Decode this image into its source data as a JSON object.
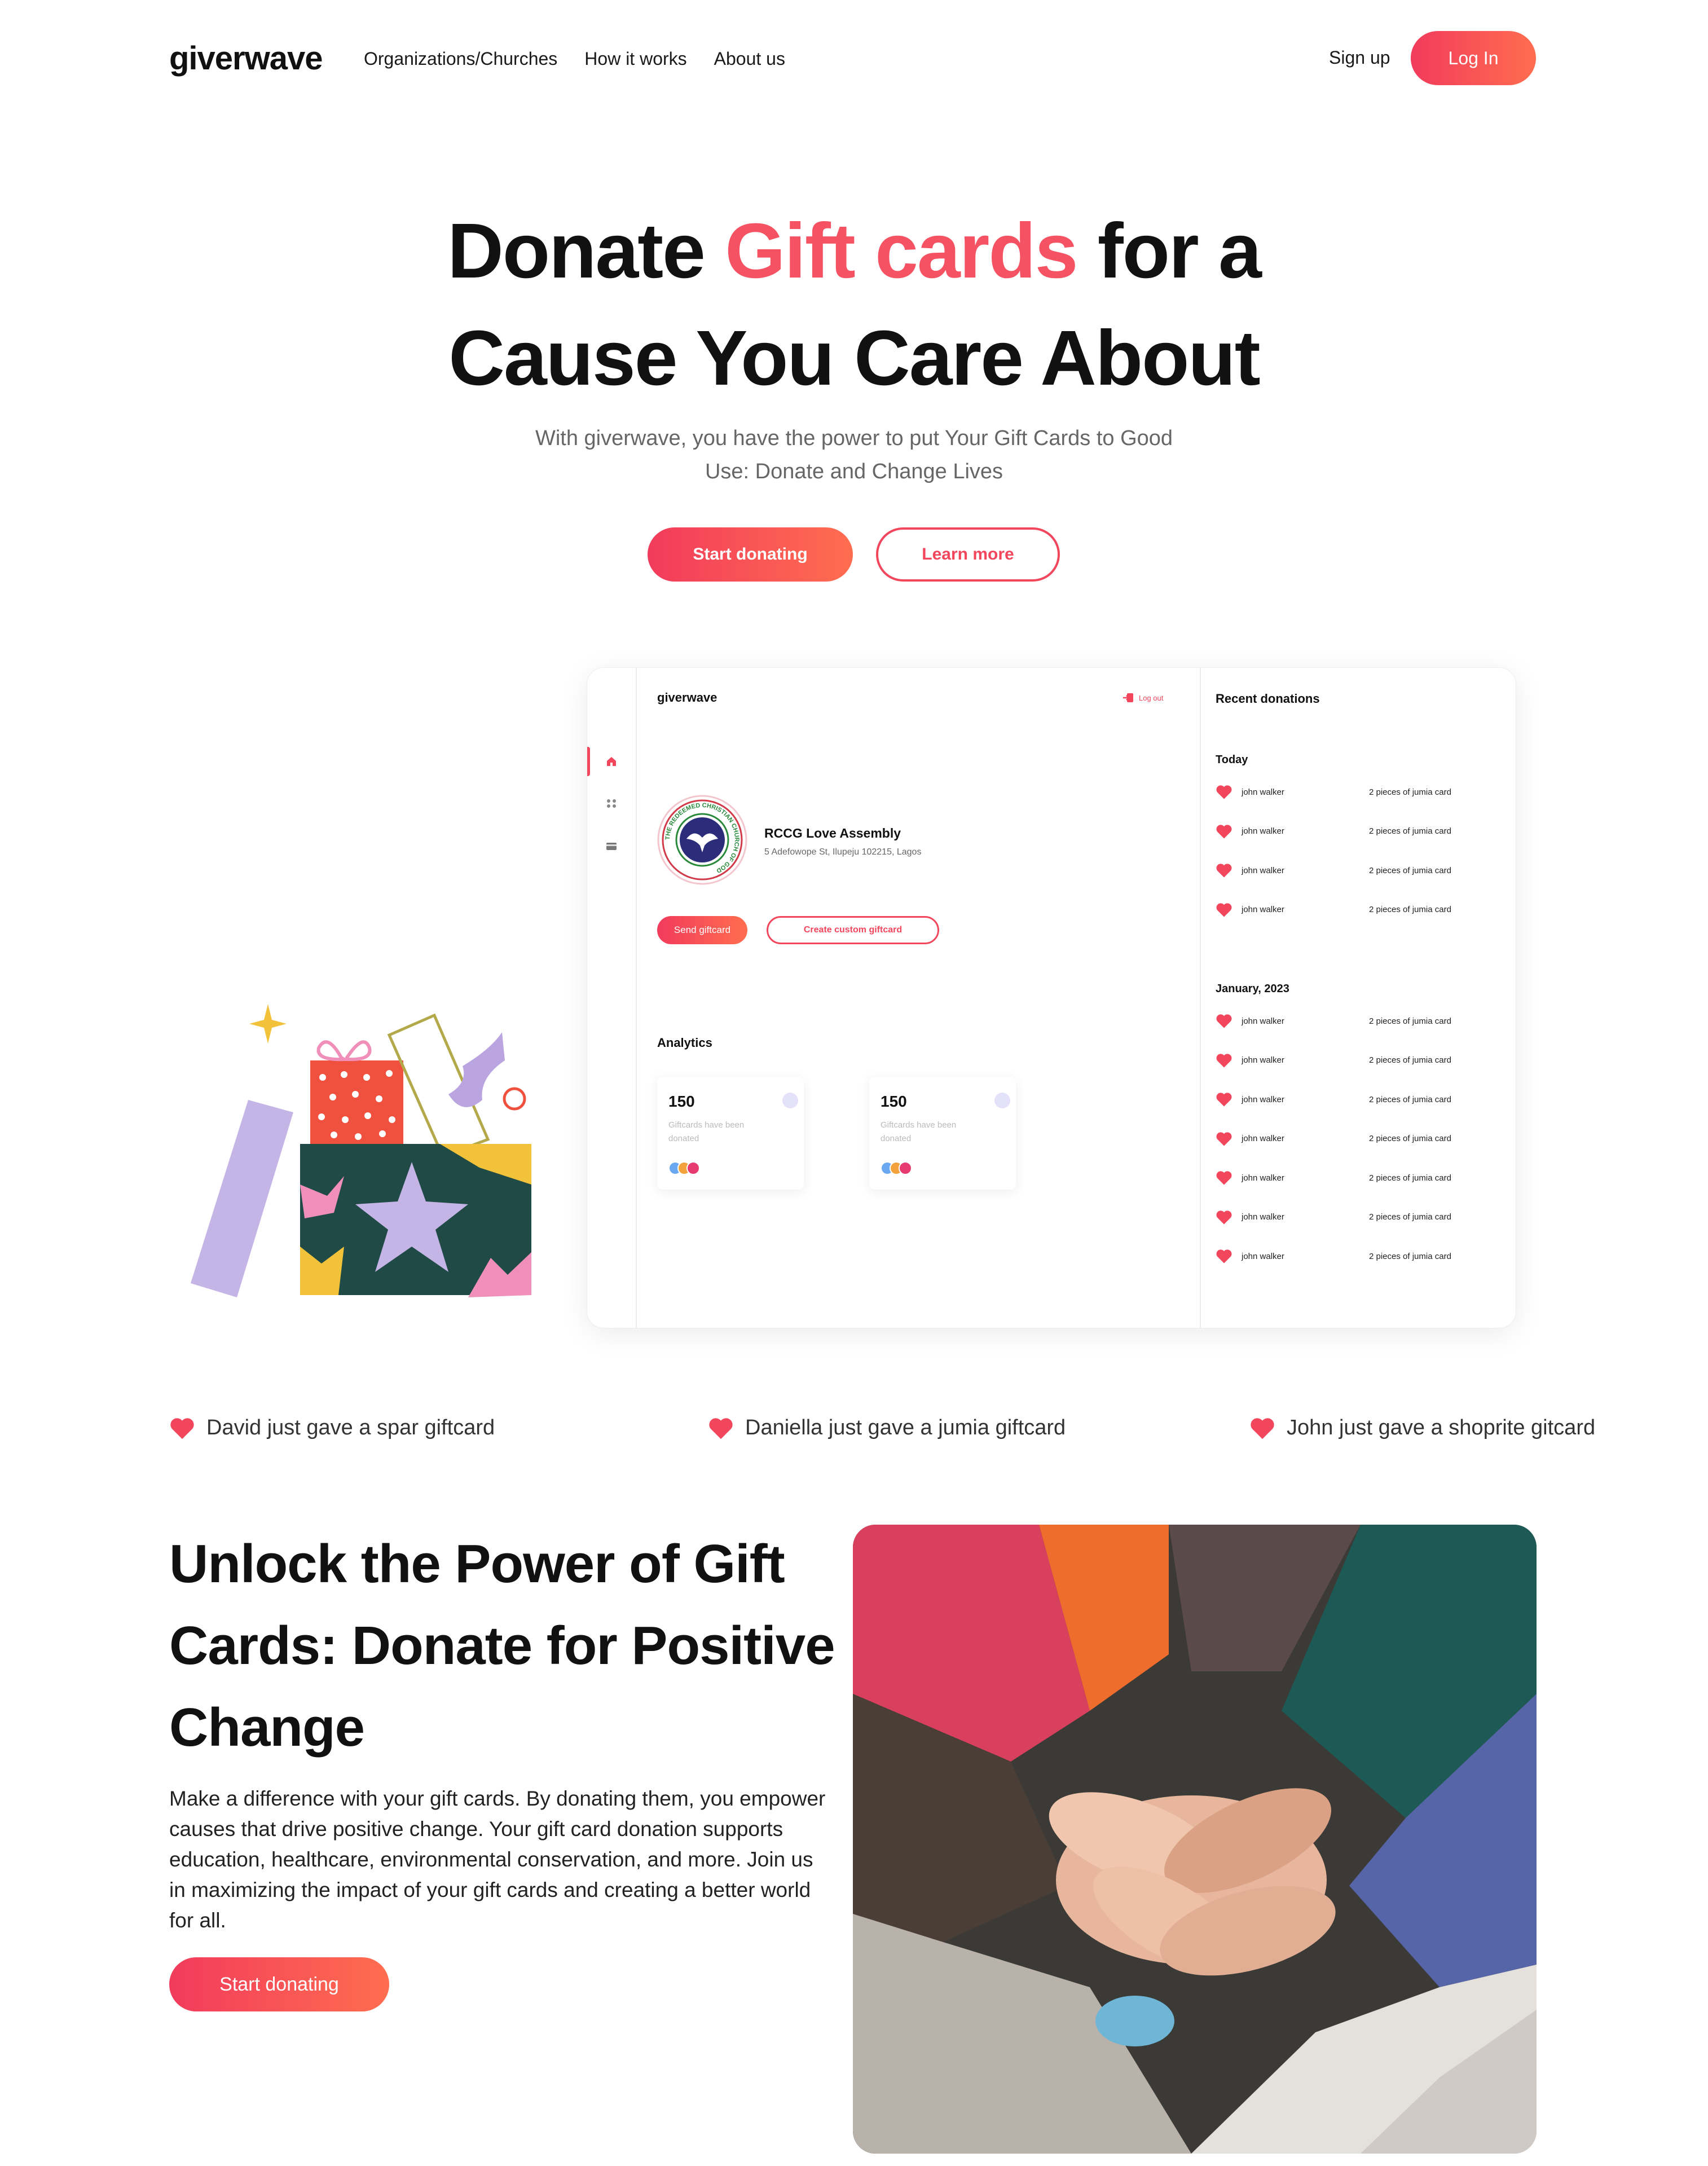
{
  "brand": "giverwave",
  "nav": {
    "links": [
      "Organizations/Churches",
      "How it works",
      "About us"
    ],
    "signup": "Sign up",
    "login": "Log In"
  },
  "hero": {
    "title_part1": "Donate ",
    "title_accent": "Gift cards",
    "title_part2": " for a",
    "title_line2": "Cause You Care About",
    "subtitle": "With giverwave, you have the power to put Your Gift Cards to Good Use: Donate and Change Lives",
    "start_button": "Start donating",
    "learn_button": "Learn more"
  },
  "dashboard": {
    "logo": "giverwave",
    "logout": "Log out",
    "org_name": "RCCG Love Assembly",
    "org_address": "5 Adefowope St, Ilupeju 102215, Lagos",
    "org_logo_ring_text": "THE REDEEMED CHRISTIAN CHURCH OF GOD",
    "send_button": "Send giftcard",
    "custom_button": "Create custom giftcard",
    "analytics_title": "Analytics",
    "stats": [
      {
        "value": "150",
        "label": "Giftcards have been donated"
      },
      {
        "value": "150",
        "label": "Giftcards have been donated"
      }
    ],
    "recent_title": "Recent donations",
    "groups": [
      {
        "label": "Today",
        "rows": [
          {
            "name": "john walker",
            "item": "2 pieces of jumia card"
          },
          {
            "name": "john walker",
            "item": "2 pieces of jumia card"
          },
          {
            "name": "john walker",
            "item": "2 pieces of jumia card"
          },
          {
            "name": "john walker",
            "item": "2 pieces of jumia card"
          }
        ]
      },
      {
        "label": "January, 2023",
        "rows": [
          {
            "name": "john walker",
            "item": "2 pieces of jumia card"
          },
          {
            "name": "john walker",
            "item": "2 pieces of jumia card"
          },
          {
            "name": "john walker",
            "item": "2 pieces of jumia card"
          },
          {
            "name": "john walker",
            "item": "2 pieces of jumia card"
          },
          {
            "name": "john walker",
            "item": "2 pieces of jumia card"
          },
          {
            "name": "john walker",
            "item": "2 pieces of jumia card"
          },
          {
            "name": "john walker",
            "item": "2 pieces of jumia card"
          }
        ]
      }
    ]
  },
  "ticker": [
    "David just gave a spar giftcard",
    "Daniella just gave a jumia giftcard",
    "John just gave a shoprite gitcard"
  ],
  "section2": {
    "title": "Unlock the Power of Gift Cards: Donate for Positive Change",
    "text": "Make a difference with your gift cards. By donating them, you empower causes that drive positive change. Your gift card donation supports education, healthcare, environmental conservation, and more. Join us in maximizing the impact of your gift cards and creating a better world for all.",
    "button": "Start donating"
  },
  "colors": {
    "accent": "#f55363",
    "gradient_start": "#f23b5c",
    "gradient_end": "#ff6d4f"
  },
  "icons": [
    "home-icon",
    "people-icon",
    "card-icon",
    "logout-icon",
    "heart-icon"
  ]
}
